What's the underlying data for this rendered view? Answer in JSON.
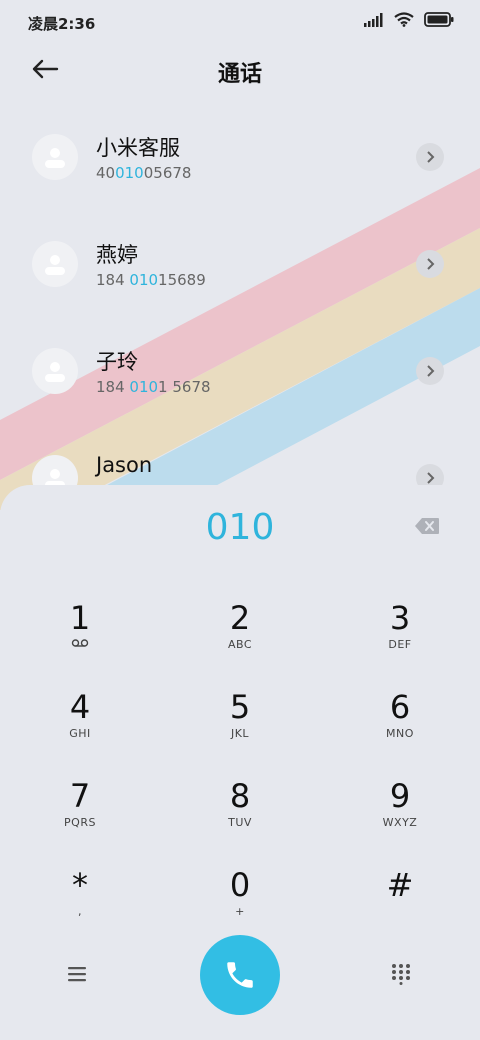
{
  "status_bar": {
    "time": "凌晨2:36"
  },
  "header": {
    "title": "通话"
  },
  "contacts": [
    {
      "name": "小米客服",
      "number_parts": [
        "40",
        "010",
        "05678"
      ]
    },
    {
      "name": "燕婷",
      "number_parts": [
        "184 ",
        "010",
        "15689"
      ]
    },
    {
      "name": "子玲",
      "number_parts": [
        "184 ",
        "010",
        "1 5678"
      ]
    },
    {
      "name": "Jason"
    }
  ],
  "dialer": {
    "input": "010",
    "keys": [
      {
        "digit": "1",
        "letters": ""
      },
      {
        "digit": "2",
        "letters": "ABC"
      },
      {
        "digit": "3",
        "letters": "DEF"
      },
      {
        "digit": "4",
        "letters": "GHI"
      },
      {
        "digit": "5",
        "letters": "JKL"
      },
      {
        "digit": "6",
        "letters": "MNO"
      },
      {
        "digit": "7",
        "letters": "PQRS"
      },
      {
        "digit": "8",
        "letters": "TUV"
      },
      {
        "digit": "9",
        "letters": "WXYZ"
      },
      {
        "digit": "*",
        "letters": ","
      },
      {
        "digit": "0",
        "letters": "+"
      },
      {
        "digit": "#",
        "letters": ""
      }
    ]
  },
  "colors": {
    "accent": "#32bee4",
    "highlight": "#2fb4dc",
    "background": "#e6e8ee"
  },
  "icons": [
    "signal-icon",
    "wifi-icon",
    "battery-icon",
    "back-arrow-icon",
    "contact-avatar-icon",
    "chevron-right-icon",
    "backspace-icon",
    "voicemail-icon",
    "menu-icon",
    "phone-icon",
    "keypad-icon"
  ]
}
